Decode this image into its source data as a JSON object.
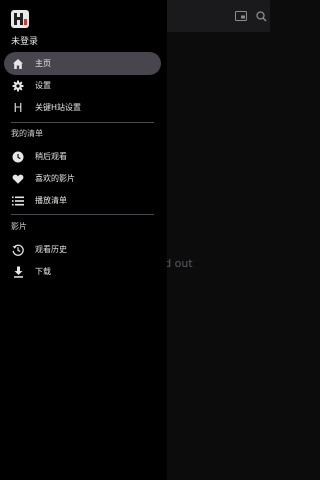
{
  "app_bar": {
    "title": ""
  },
  "background": {
    "message": "connect timed out"
  },
  "drawer": {
    "user_status": "未登录",
    "main_items": [
      {
        "label": "主页",
        "icon": "home-icon"
      },
      {
        "label": "设置",
        "icon": "gear-icon"
      },
      {
        "label": "关键H站设置",
        "icon": "h-icon"
      }
    ],
    "my_list": {
      "header": "我的清单",
      "items": [
        {
          "label": "稍后观看",
          "icon": "clock-icon"
        },
        {
          "label": "喜欢的影片",
          "icon": "heart-icon"
        },
        {
          "label": "播放清单",
          "icon": "playlist-icon"
        }
      ]
    },
    "videos": {
      "header": "影片",
      "items": [
        {
          "label": "观看历史",
          "icon": "history-icon"
        },
        {
          "label": "下载",
          "icon": "download-icon"
        }
      ]
    }
  },
  "colors": {
    "drawer_bg": "#000000",
    "active_pill": "#48454f",
    "logo_accent": "#d23a3a"
  }
}
